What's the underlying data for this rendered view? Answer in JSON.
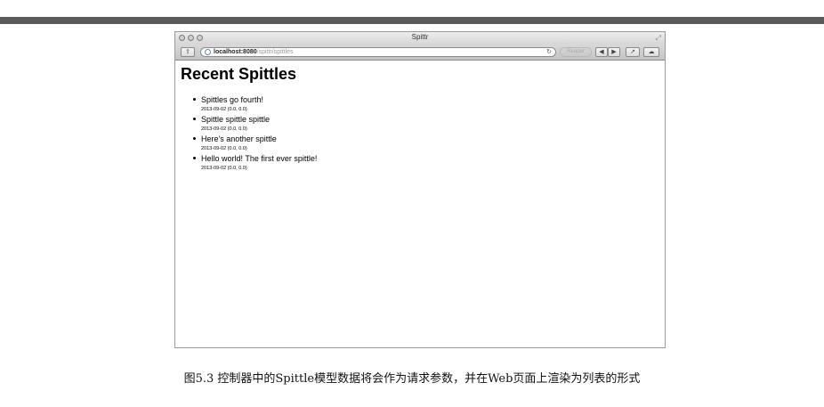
{
  "window": {
    "title": "Spittr",
    "url_host": "localhost:8080",
    "url_path": "/spittr/spittles",
    "reader_label": "Reader",
    "reload_icon": "reload-icon"
  },
  "page": {
    "heading": "Recent Spittles",
    "spittles": [
      {
        "message": "Spittles go fourth!",
        "meta": "2013-09-02 (0.0, 0.0)"
      },
      {
        "message": "Spittle spittle spittle",
        "meta": "2013-09-02 (0.0, 0.0)"
      },
      {
        "message": "Here's another spittle",
        "meta": "2013-09-02 (0.0, 0.0)"
      },
      {
        "message": "Hello world! The first ever spittle!",
        "meta": "2013-09-02 (0.0, 0.0)"
      }
    ]
  },
  "caption": "图5.3  控制器中的Spittle模型数据将会作为请求参数，并在Web页面上渲染为列表的形式",
  "colors": {
    "top_bar": "#5a5a5a",
    "window_border": "#9a9a9a"
  }
}
